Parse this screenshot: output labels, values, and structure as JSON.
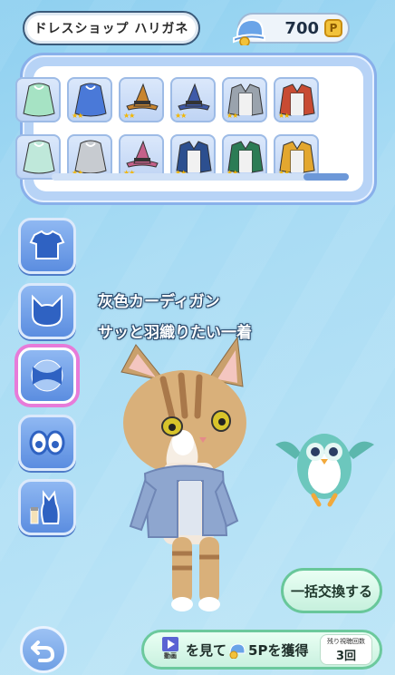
{
  "header": {
    "shop_name": "ドレスショップ ハリガネ",
    "points_value": "700",
    "points_unit": "P"
  },
  "items": {
    "row1": [
      {
        "icon": "cape-icon",
        "color": "#a6e3c4",
        "stars": ""
      },
      {
        "icon": "cape-icon",
        "color": "#4a79d8",
        "stars": "★★"
      },
      {
        "icon": "witch-hat-icon",
        "color": "#c9852f",
        "stars": "★★"
      },
      {
        "icon": "witch-hat-icon",
        "color": "#3f5aa8",
        "stars": "★★"
      },
      {
        "icon": "cardigan-icon",
        "color": "#9aa3ad",
        "stars": "★★"
      },
      {
        "icon": "cardigan-icon",
        "color": "#c84b33",
        "stars": "★★"
      }
    ],
    "row2": [
      {
        "icon": "cape-icon",
        "color": "#bfe8da",
        "stars": ""
      },
      {
        "icon": "cape-icon",
        "color": "#c7cbd0",
        "stars": "★★"
      },
      {
        "icon": "witch-hat-icon",
        "color": "#c4618a",
        "stars": "★★"
      },
      {
        "icon": "cardigan-icon",
        "color": "#2c4f8f",
        "stars": "★★"
      },
      {
        "icon": "cardigan-icon",
        "color": "#2c7c55",
        "stars": "★★"
      },
      {
        "icon": "cardigan-icon",
        "color": "#e3a72f",
        "stars": "★★"
      }
    ]
  },
  "categories": [
    {
      "name": "clothes-category",
      "icon": "shirt-icon"
    },
    {
      "name": "head-category",
      "icon": "cat-head-icon"
    },
    {
      "name": "fur-pattern-category",
      "icon": "pattern-icon"
    },
    {
      "name": "eyes-category",
      "icon": "eyes-icon"
    },
    {
      "name": "color-category",
      "icon": "paint-icon"
    }
  ],
  "description": {
    "item_name": "灰色カーディガン",
    "item_text": "サッと羽織りたい一着"
  },
  "buttons": {
    "exchange_all": "一括交換する",
    "ad_play_label": "動画",
    "ad_text": "を見て",
    "ad_reward": "5Pを獲得",
    "ad_remaining_label": "残り視聴回数",
    "ad_remaining": "3回"
  }
}
